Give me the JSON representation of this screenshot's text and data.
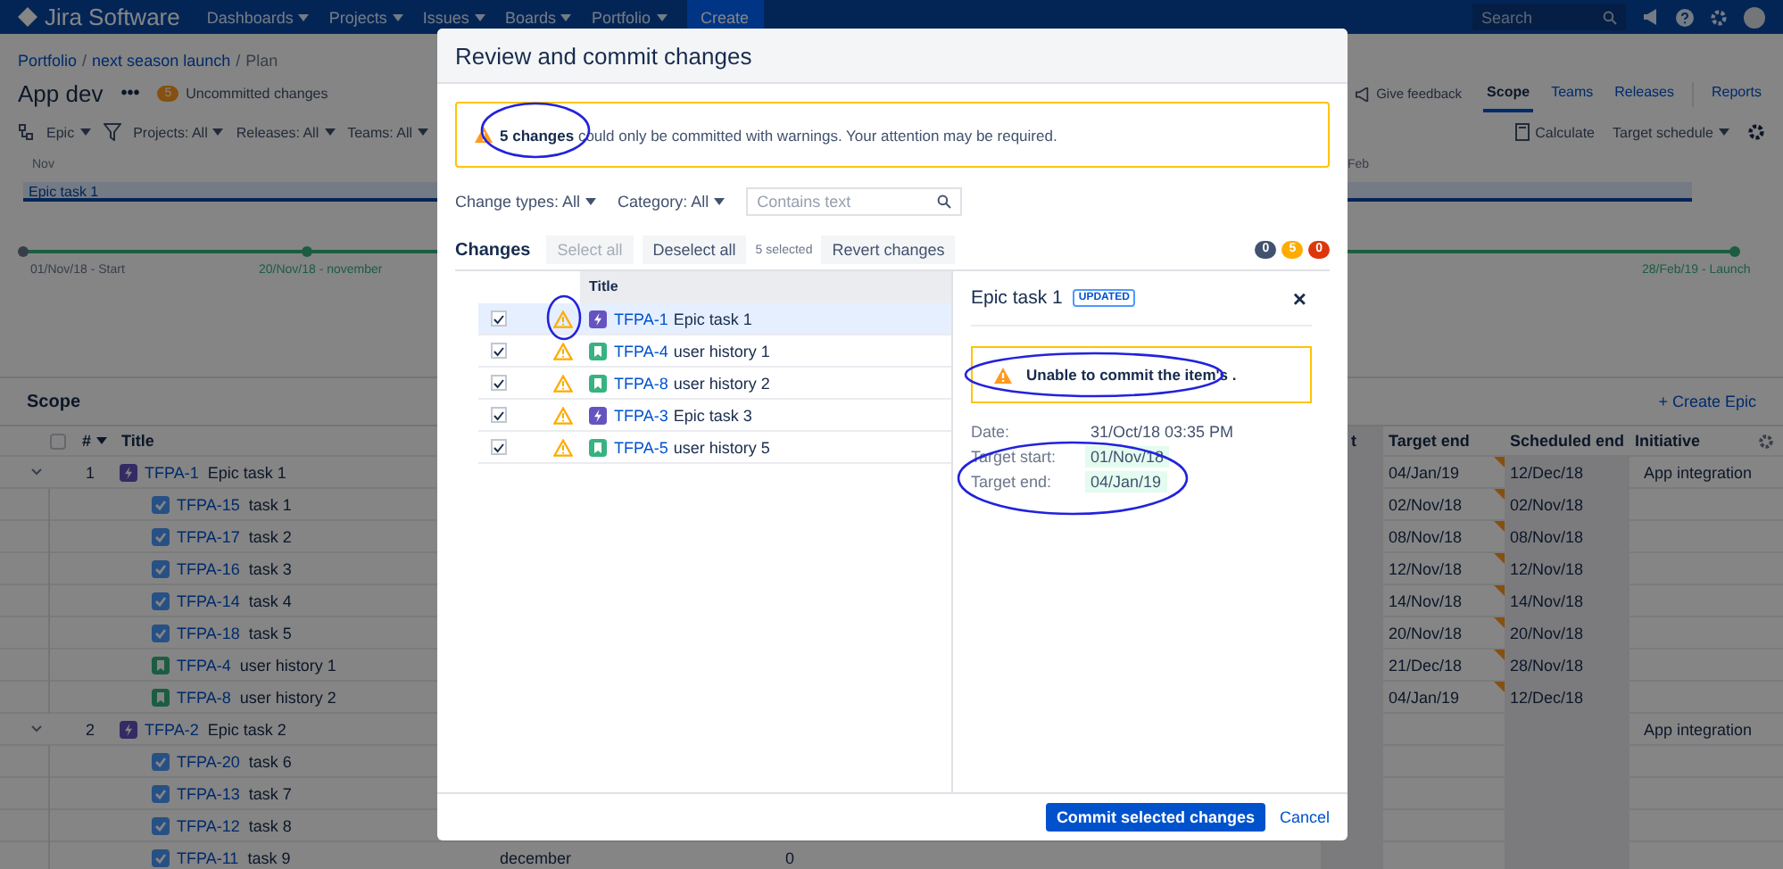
{
  "top_nav": {
    "logo": "Jira Software",
    "menus": [
      {
        "label": "Dashboards"
      },
      {
        "label": "Projects"
      },
      {
        "label": "Issues"
      },
      {
        "label": "Boards"
      },
      {
        "label": "Portfolio"
      }
    ],
    "create_button": "Create",
    "search": {
      "placeholder": "Search"
    }
  },
  "breadcrumbs": {
    "separator": "/",
    "items": [
      "Portfolio",
      "next season launch",
      "Plan"
    ]
  },
  "plan_header": {
    "title": "App dev",
    "more_button": "•••",
    "uncommitted_count": "5",
    "uncommitted_label": "Uncommitted changes",
    "feedback": "Give feedback",
    "tabs": [
      {
        "label": "Scope",
        "selected": true
      },
      {
        "label": "Teams",
        "selected": false
      },
      {
        "label": "Releases",
        "selected": false
      },
      {
        "label": "Reports",
        "selected": false
      }
    ]
  },
  "toolbar": {
    "hierarchy": "Epic",
    "filters": [
      "Projects: All",
      "Releases: All",
      "Teams: All"
    ],
    "calculate": "Calculate",
    "schedule": "Target schedule"
  },
  "timeline": {
    "months": [
      "Nov",
      "Feb"
    ],
    "bar_label": "Epic task 1",
    "milestones": [
      {
        "label": "01/Nov/18 - Start",
        "kind": "start"
      },
      {
        "label": "20/Nov/18 - november",
        "kind": "release"
      },
      {
        "label": "28/Feb/19 - Launch",
        "kind": "release"
      }
    ]
  },
  "scope": {
    "title": "Scope",
    "create_link": "+ Create Epic",
    "header_checked": false,
    "columns": [
      "#",
      "Title",
      "t",
      "Target end",
      "Scheduled end",
      "Initiative"
    ],
    "rows": [
      {
        "kind": "epic",
        "number": "1",
        "expanded": true,
        "key": "TFPA-1",
        "summary": "Epic task 1",
        "target_end": "04/Jan/19",
        "changed": true,
        "scheduled_end": "12/Dec/18",
        "initiative": "App integration",
        "children": [
          {
            "kind": "task",
            "key": "TFPA-15",
            "summary": "task 1",
            "target_end": "02/Nov/18",
            "changed": true,
            "scheduled_end": "02/Nov/18"
          },
          {
            "kind": "task",
            "key": "TFPA-17",
            "summary": "task 2",
            "target_end": "08/Nov/18",
            "changed": true,
            "scheduled_end": "08/Nov/18"
          },
          {
            "kind": "task",
            "key": "TFPA-16",
            "summary": "task 3",
            "target_end": "12/Nov/18",
            "changed": true,
            "scheduled_end": "12/Nov/18"
          },
          {
            "kind": "task",
            "key": "TFPA-14",
            "summary": "task 4",
            "target_end": "14/Nov/18",
            "changed": true,
            "scheduled_end": "14/Nov/18"
          },
          {
            "kind": "task",
            "key": "TFPA-18",
            "summary": "task 5",
            "target_end": "20/Nov/18",
            "changed": true,
            "scheduled_end": "20/Nov/18"
          },
          {
            "kind": "story",
            "key": "TFPA-4",
            "summary": "user history 1",
            "target_end": "21/Dec/18",
            "changed": true,
            "scheduled_end": "28/Nov/18"
          },
          {
            "kind": "story",
            "key": "TFPA-8",
            "summary": "user history 2",
            "target_end": "04/Jan/19",
            "changed": true,
            "scheduled_end": "12/Dec/18"
          }
        ]
      },
      {
        "kind": "epic",
        "number": "2",
        "expanded": true,
        "key": "TFPA-2",
        "summary": "Epic task 2",
        "changed": false,
        "initiative": "App integration",
        "children": [
          {
            "kind": "task",
            "key": "TFPA-20",
            "summary": "task 6",
            "changed": false
          },
          {
            "kind": "task",
            "key": "TFPA-13",
            "summary": "task 7",
            "changed": false
          },
          {
            "kind": "task",
            "key": "TFPA-12",
            "summary": "task 8",
            "changed": false
          },
          {
            "kind": "task",
            "key": "TFPA-11",
            "summary": "task 9",
            "changed": false,
            "column_3": "december",
            "column_4": "0"
          }
        ]
      }
    ]
  },
  "commit_dialog": {
    "title": "Review and commit changes",
    "warning": "**5 changes** could only be committed with warnings. Your attention may be required.",
    "filters": [
      "Change types: All",
      "Category: All"
    ],
    "search": {
      "placeholder": "Contains text"
    },
    "changes_label": "Changes",
    "actions": [
      {
        "label": "Select all",
        "disabled": true
      },
      {
        "label": "Deselect all",
        "disabled": false
      }
    ],
    "selected_count": "5 selected",
    "revert_button": "Revert changes",
    "counters": [
      {
        "count": "0",
        "color": "#42526e"
      },
      {
        "count": "5",
        "color": "#ffab00"
      },
      {
        "count": "0",
        "color": "#de350b"
      }
    ],
    "list_header": "Title",
    "changes": [
      {
        "checked": true,
        "warning": true,
        "kind": "epic",
        "key": "TFPA-1",
        "summary": "Epic task 1",
        "selected": true
      },
      {
        "checked": true,
        "warning": true,
        "kind": "story",
        "key": "TFPA-4",
        "summary": "user history 1",
        "selected": false
      },
      {
        "checked": true,
        "warning": true,
        "kind": "story",
        "key": "TFPA-8",
        "summary": "user history 2",
        "selected": false
      },
      {
        "checked": true,
        "warning": true,
        "kind": "epic",
        "key": "TFPA-3",
        "summary": "Epic task 3",
        "selected": false
      },
      {
        "checked": true,
        "warning": true,
        "kind": "story",
        "key": "TFPA-5",
        "summary": "user history 5",
        "selected": false
      }
    ],
    "detail": {
      "title": "Epic task 1",
      "status": "UPDATED",
      "close": "×",
      "warning": "Unable to commit the item's .",
      "fields": [
        {
          "label": "Date:",
          "value": "31/Oct/18 03:35 PM",
          "changed": false
        },
        {
          "label": "Target start:",
          "value": "01/Nov/18",
          "changed": true
        },
        {
          "label": "Target end:",
          "value": "04/Jan/19",
          "changed": true
        }
      ]
    },
    "commit_button": "Commit selected changes",
    "cancel_button": "Cancel"
  }
}
